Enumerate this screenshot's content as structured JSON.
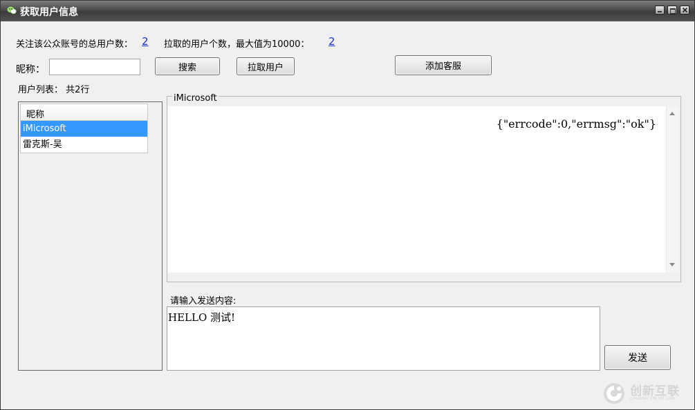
{
  "window": {
    "title": "获取用户信息",
    "app_icon": "wechat-icon",
    "controls": [
      "minimize-icon",
      "maximize-icon",
      "close-icon"
    ]
  },
  "stats": {
    "total_label": "关注该公众账号的总用户数：",
    "total_value": "2",
    "pulled_label": "拉取的用户个数，最大值为10000：",
    "pulled_value": "2"
  },
  "search": {
    "label": "昵称：",
    "value": "",
    "search_button": "搜索",
    "pull_button": "拉取用户",
    "add_service_button": "添加客服"
  },
  "user_list": {
    "summary": "用户列表： 共2行",
    "column_header": "昵称",
    "rows": [
      "iMicrosoft",
      "雷克斯-吴"
    ],
    "selected": "iMicrosoft"
  },
  "detail": {
    "group_title": "iMicrosoft",
    "response_text": "{\"errcode\":0,\"errmsg\":\"ok\"}"
  },
  "compose": {
    "label": "请输入发送内容:",
    "value": "HELLO 测试!",
    "send_button": "发送"
  },
  "watermark": {
    "text": "创新互联",
    "subtext": "CHUANG XIN HU LIAN",
    "icon": "logo-icon"
  },
  "colors": {
    "selection": "#3399ff",
    "link": "#1a33c8",
    "titlebar": "#4a4a4a"
  }
}
